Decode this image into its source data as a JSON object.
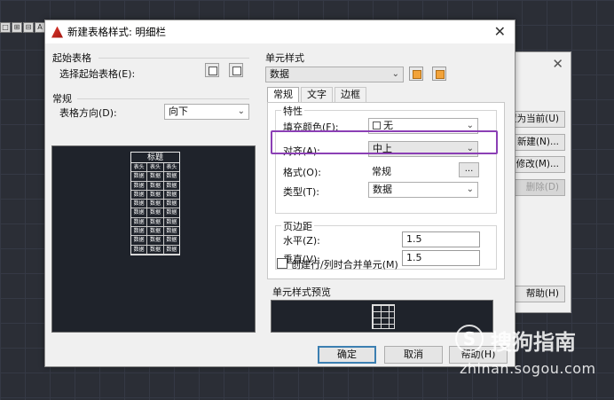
{
  "workspace": {
    "toolbar_icons": [
      "□",
      "⊞",
      "⊟",
      "A"
    ]
  },
  "bg_dialog": {
    "close_label": "✕",
    "buttons": [
      "置为当前(U)",
      "新建(N)...",
      "修改(M)...",
      "删除(D)",
      "帮助(H)"
    ]
  },
  "dialog": {
    "title": "新建表格样式: 明细栏",
    "close_label": "✕",
    "start_table": {
      "group_label": "起始表格",
      "select_label": "选择起始表格(E):"
    },
    "general": {
      "group_label": "常规",
      "direction_label": "表格方向(D):",
      "direction_value": "向下"
    },
    "mini_table": {
      "title": "标题",
      "header_row": [
        "表头",
        "表头",
        "表头"
      ],
      "data_cell": "数据",
      "data_row_count": 9
    },
    "cell_style": {
      "group_label": "单元样式",
      "value": "数据",
      "tabs": [
        "常规",
        "文字",
        "边框"
      ],
      "properties": {
        "legend": "特性",
        "fill_color_label": "填充颜色(F):",
        "fill_color_value": "无",
        "align_label": "对齐(A):",
        "align_value": "中上",
        "format_label": "格式(O):",
        "format_value": "常规",
        "format_button": "...",
        "type_label": "类型(T):",
        "type_value": "数据"
      },
      "margins": {
        "legend": "页边距",
        "horizontal_label": "水平(Z):",
        "horizontal_value": "1.5",
        "vertical_label": "垂直(V):",
        "vertical_value": "1.5"
      },
      "merge_label": "创建行/列时合并单元(M)",
      "merge_checked": false,
      "preview_label": "单元样式预览"
    },
    "buttons": {
      "ok": "确定",
      "cancel": "取消",
      "help": "帮助(H)"
    }
  },
  "watermark": {
    "logo": "S",
    "name": "搜狗指南",
    "url": "zhinan.sogou.com"
  },
  "colors": {
    "highlight": "#8b3fb5",
    "workspace_bg": "#2b2e36",
    "preview_bg": "#1f232b"
  }
}
